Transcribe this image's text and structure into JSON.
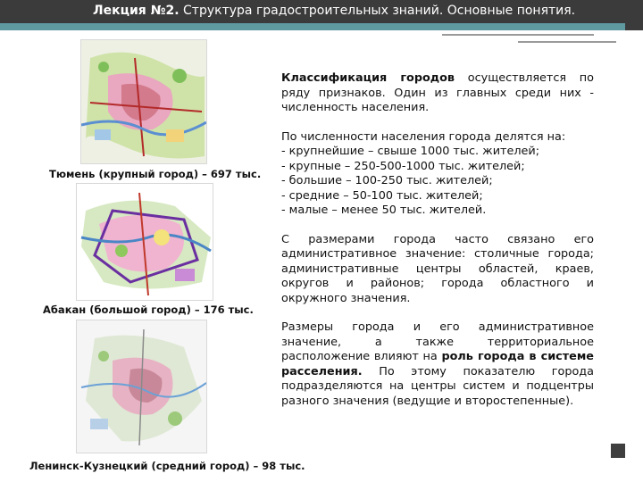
{
  "header": {
    "title_bold": "Лекция №2.",
    "title_rest": " Структура градостроительных знаний. Основные понятия."
  },
  "maps": [
    {
      "caption": "Тюмень (крупный город) – 697 тыс.",
      "icon": "city-map-tyumen"
    },
    {
      "caption": "Абакан (большой город) – 176 тыс.",
      "icon": "city-map-abakan"
    },
    {
      "caption": "Ленинск-Кузнецкий (средний город) – 98 тыс.",
      "icon": "city-map-leninsk-kuznetsky"
    }
  ],
  "text": {
    "p1_bold": "Классификация городов",
    "p1_rest": " осуществляется по ряду признаков. Один из главных среди них - численность населения.",
    "list_intro": "По численности населения города делятся на:",
    "list": [
      "- крупнейшие – свыше 1000 тыс. жителей;",
      "- крупные – 250-500-1000 тыс. жителей;",
      "- большие – 100-250 тыс. жителей;",
      "- средние – 50-100 тыс. жителей;",
      "- малые – менее 50 тыс. жителей."
    ],
    "p2": "С размерами города часто связано его административное значение: столичные города; административные центры областей, краев, округов и районов; города областного и окружного значения.",
    "p3_a": "Размеры города и его административное значение, а также территориальное расположение влияют на ",
    "p3_bold": "роль города в системе расселения.",
    "p3_b": " По этому показателю города подразделяются на центры систем и подцентры разного значения (ведущие и второстепенные)."
  },
  "colors": {
    "header_bg": "#3b3b3b",
    "accent": "#5e9aa0"
  }
}
